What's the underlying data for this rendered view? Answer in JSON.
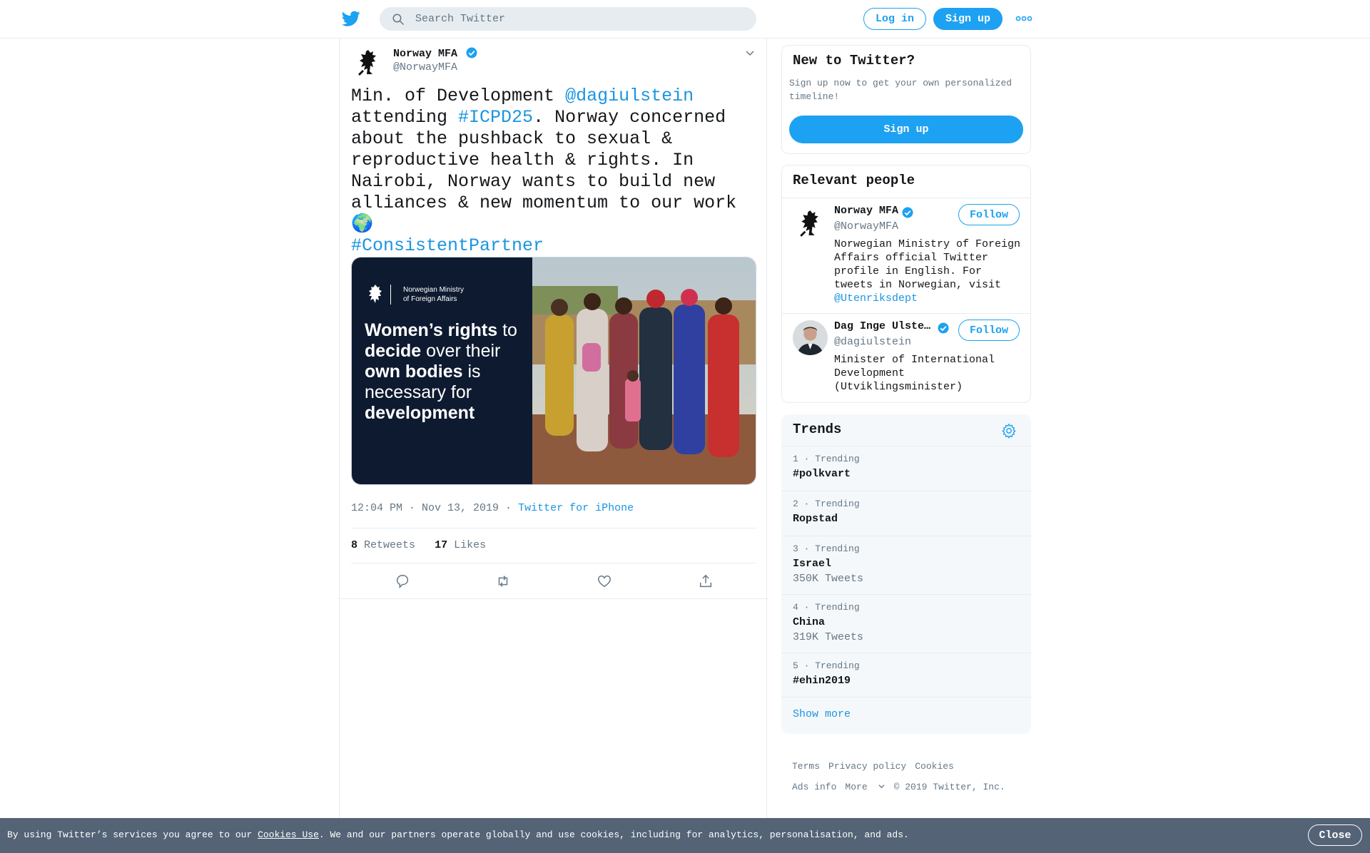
{
  "topbar": {
    "search_placeholder": "Search Twitter",
    "login_label": "Log in",
    "signup_label": "Sign up",
    "brand_color": "#1da1f2"
  },
  "tweet": {
    "author_name": "Norway MFA",
    "author_handle": "@NorwayMFA",
    "text_parts": {
      "p1": "Min. of Development ",
      "mention": "@dagiulstein",
      "p2": " attending ",
      "hashtag1": "#ICPD25",
      "p3": ". Norway concerned about the pushback to sexual & reproductive health & rights. In Nairobi, Norway wants to build new alliances & new momentum to our work ",
      "emoji": "🌍",
      "hashtag2": "#ConsistentPartner"
    },
    "media": {
      "org_line1": "Norwegian Ministry",
      "org_line2": "of Foreign Affairs",
      "headline": {
        "h1": "Women’s rights",
        "h2": " to ",
        "h3": "decide",
        "h4": " over their ",
        "h5": "own bodies",
        "h6": " is necessary for ",
        "h7": "development"
      }
    },
    "time": "12:04 PM · Nov 13, 2019",
    "separator": " · ",
    "source": "Twitter for iPhone",
    "retweets_count": "8",
    "retweets_label": "Retweets",
    "likes_count": "17",
    "likes_label": "Likes"
  },
  "new_to_twitter": {
    "title": "New to Twitter?",
    "desc": "Sign up now to get your own personalized timeline!",
    "button": "Sign up"
  },
  "relevant_people": {
    "title": "Relevant people",
    "people": [
      {
        "name": "Norway MFA",
        "handle": "@NorwayMFA",
        "bio": "Norwegian Ministry of Foreign Affairs official Twitter profile in English. For tweets in Norwegian, visit ",
        "bio_link": "@Utenriksdept",
        "follow": "Follow"
      },
      {
        "name": "Dag Inge Ulstein",
        "handle": "@dagiulstein",
        "bio": "Minister of International Development (Utviklingsminister)",
        "follow": "Follow"
      }
    ]
  },
  "trends": {
    "title": "Trends",
    "items": [
      {
        "meta": "1 · Trending",
        "name": "#polkvart",
        "count": ""
      },
      {
        "meta": "2 · Trending",
        "name": "Ropstad",
        "count": ""
      },
      {
        "meta": "3 · Trending",
        "name": "Israel",
        "count": "350K Tweets"
      },
      {
        "meta": "4 · Trending",
        "name": "China",
        "count": "319K Tweets"
      },
      {
        "meta": "5 · Trending",
        "name": "#ehin2019",
        "count": ""
      }
    ],
    "show_more": "Show more"
  },
  "footer": {
    "terms": "Terms",
    "privacy": "Privacy policy",
    "cookies": "Cookies",
    "ads": "Ads info",
    "more": "More",
    "copyright": "© 2019 Twitter, Inc."
  },
  "cookie_bar": {
    "text_before": "By using Twitter’s services you agree to our ",
    "link": "Cookies Use",
    "text_after": ". We and our partners operate globally and use cookies, including for analytics, personalisation, and ads.",
    "close": "Close"
  }
}
